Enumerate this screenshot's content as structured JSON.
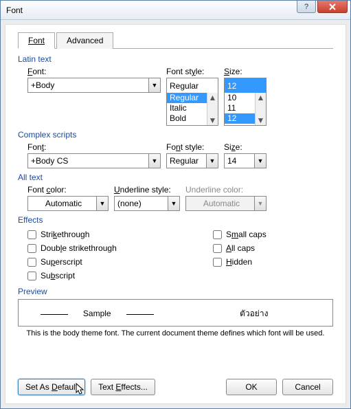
{
  "title": "Font",
  "tabs": {
    "font": "Font",
    "advanced": "Advanced"
  },
  "latin": {
    "group": "Latin text",
    "font_label": "Font:",
    "font_value": "+Body",
    "style_label": "Font style:",
    "style_value": "Regular",
    "style_opts": [
      "Regular",
      "Italic",
      "Bold"
    ],
    "size_label": "Size:",
    "size_value": "12",
    "size_opts": [
      "10",
      "11",
      "12"
    ]
  },
  "complex": {
    "group": "Complex scripts",
    "font_label": "Font:",
    "font_value": "+Body CS",
    "style_label": "Font style:",
    "style_value": "Regular",
    "size_label": "Size:",
    "size_value": "14"
  },
  "alltext": {
    "group": "All text",
    "color_label": "Font color:",
    "color_value": "Automatic",
    "ustyle_label": "Underline style:",
    "ustyle_value": "(none)",
    "ucolor_label": "Underline color:",
    "ucolor_value": "Automatic"
  },
  "effects": {
    "group": "Effects",
    "strike": "Strikethrough",
    "dstrike": "Double strikethrough",
    "super": "Superscript",
    "sub": "Subscript",
    "smallcaps": "Small caps",
    "allcaps": "All caps",
    "hidden": "Hidden"
  },
  "preview": {
    "group": "Preview",
    "sample1": "Sample",
    "sample2": "ตัวอย่าง",
    "desc": "This is the body theme font. The current document theme defines which font will be used."
  },
  "buttons": {
    "default": "Set As Default",
    "texteffects": "Text Effects...",
    "ok": "OK",
    "cancel": "Cancel"
  }
}
